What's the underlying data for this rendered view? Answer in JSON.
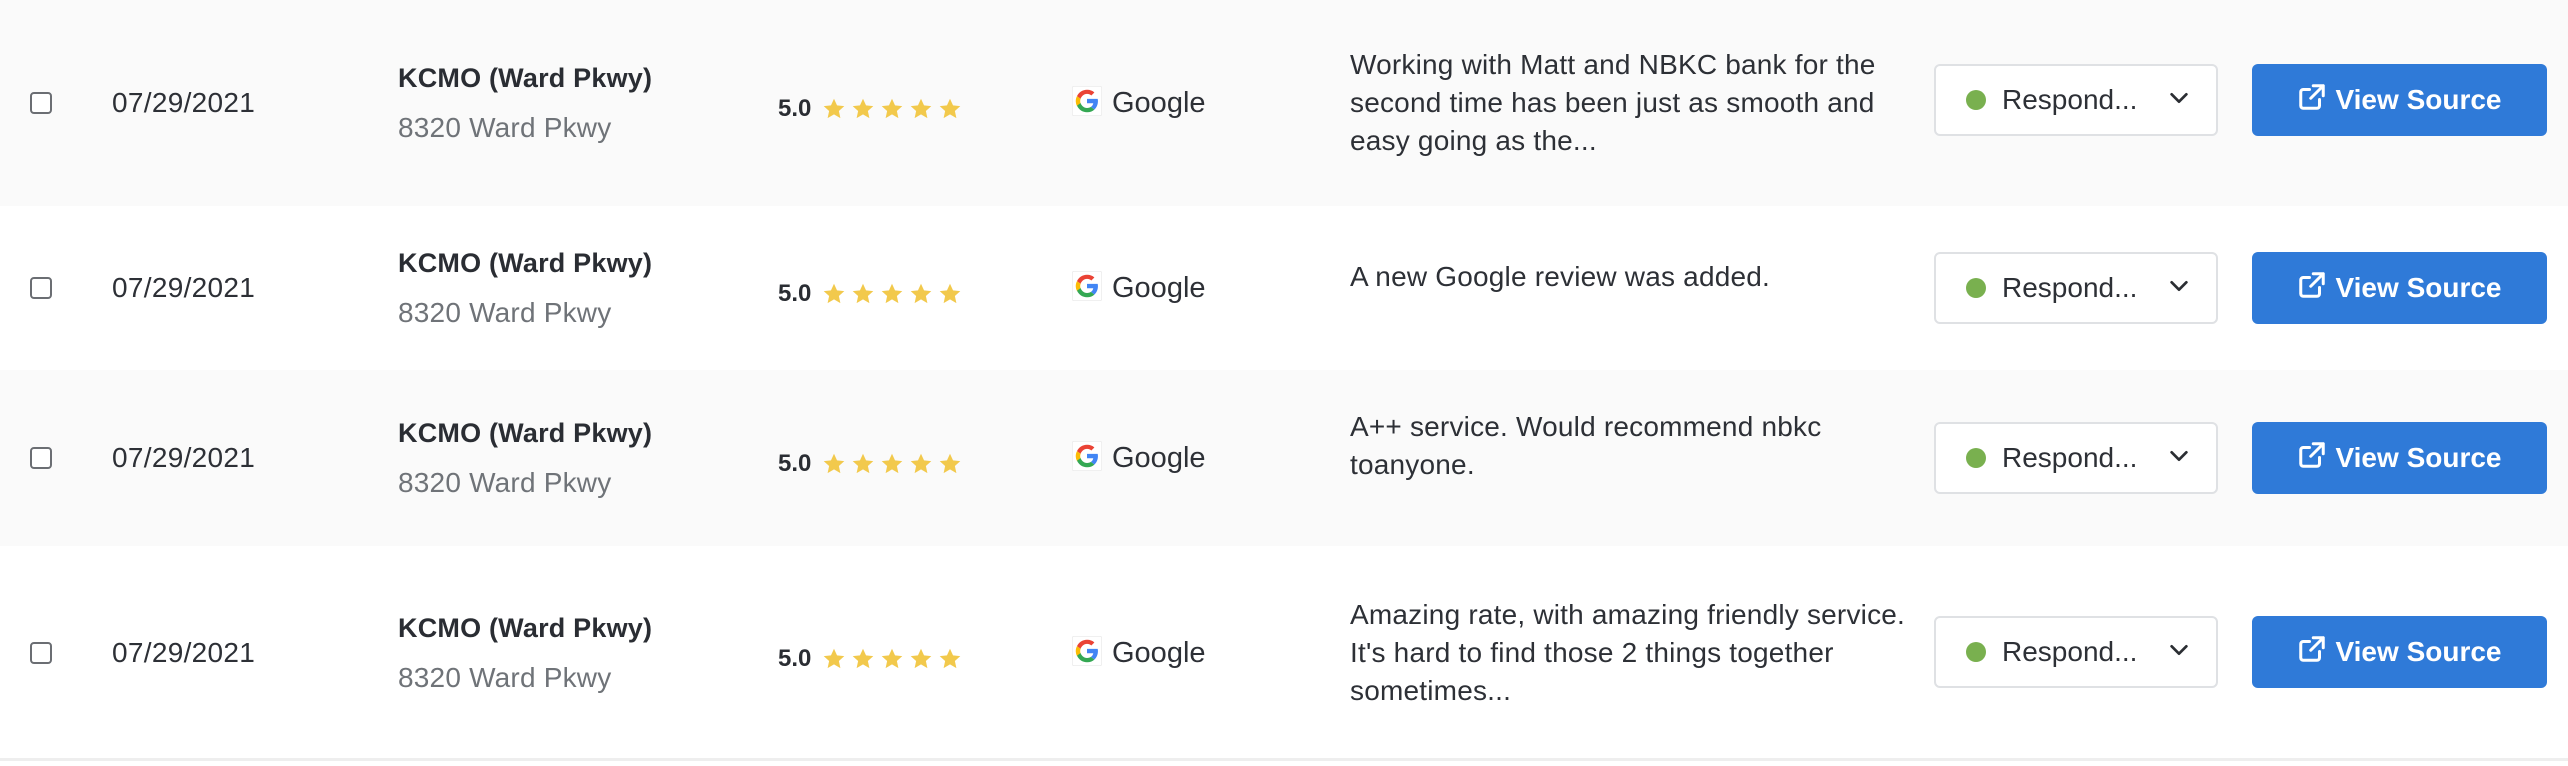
{
  "colors": {
    "accent": "#2f7ad8",
    "status_dot": "#79b04f",
    "star": "#f2c94c",
    "row_alt_bg": "#fafafa"
  },
  "rows": [
    {
      "date": "07/29/2021",
      "location_name": "KCMO (Ward Pkwy)",
      "location_address": "8320 Ward Pkwy",
      "rating": "5.0",
      "stars": 5,
      "source": "Google",
      "source_icon": "google-g-icon",
      "review_text": "Working with Matt and NBKC bank for the second time has been just as smooth and easy going as the...",
      "status": "Respond...",
      "view_button": "View Source"
    },
    {
      "date": "07/29/2021",
      "location_name": "KCMO (Ward Pkwy)",
      "location_address": "8320 Ward Pkwy",
      "rating": "5.0",
      "stars": 5,
      "source": "Google",
      "source_icon": "google-g-icon",
      "review_text": "A new Google review was added.",
      "status": "Respond...",
      "view_button": "View Source"
    },
    {
      "date": "07/29/2021",
      "location_name": "KCMO (Ward Pkwy)",
      "location_address": "8320 Ward Pkwy",
      "rating": "5.0",
      "stars": 5,
      "source": "Google",
      "source_icon": "google-g-icon",
      "review_text": "A++ service. Would recommend nbkc toanyone.",
      "status": "Respond...",
      "view_button": "View Source"
    },
    {
      "date": "07/29/2021",
      "location_name": "KCMO (Ward Pkwy)",
      "location_address": "8320 Ward Pkwy",
      "rating": "5.0",
      "stars": 5,
      "source": "Google",
      "source_icon": "google-g-icon",
      "review_text": "Amazing rate, with amazing friendly service. It's hard to find those 2 things together sometimes...",
      "status": "Respond...",
      "view_button": "View Source"
    }
  ]
}
